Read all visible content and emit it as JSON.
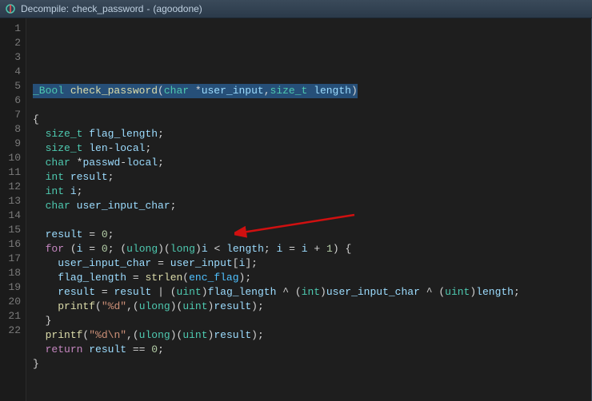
{
  "titlebar": {
    "prefix": "Decompile:",
    "func": "check_password",
    "dash": "-",
    "project": "(agoodone)"
  },
  "lines": {
    "l1": "",
    "l2": "_Bool check_password(char *user_input,size_t length)",
    "l3": "",
    "l4": "{",
    "l5": "  size_t flag_length;",
    "l6": "  size_t len-local;",
    "l7": "  char *passwd-local;",
    "l8": "  int result;",
    "l9": "  int i;",
    "l10": "  char user_input_char;",
    "l11": "",
    "l12": "  result = 0;",
    "l13": "  for (i = 0; (ulong)(long)i < length; i = i + 1) {",
    "l14": "    user_input_char = user_input[i];",
    "l15": "    flag_length = strlen(enc_flag);",
    "l16": "    result = result | (uint)flag_length ^ (int)user_input_char ^ (uint)length;",
    "l17": "    printf(\"%d\",(ulong)(uint)result);",
    "l18": "  }",
    "l19": "  printf(\"%d\\n\",(ulong)(uint)result);",
    "l20": "  return result == 0;",
    "l21": "}",
    "l22": ""
  },
  "line_numbers": [
    "1",
    "2",
    "3",
    "4",
    "5",
    "6",
    "7",
    "8",
    "9",
    "10",
    "11",
    "12",
    "13",
    "14",
    "15",
    "16",
    "17",
    "18",
    "19",
    "20",
    "21",
    "22"
  ]
}
